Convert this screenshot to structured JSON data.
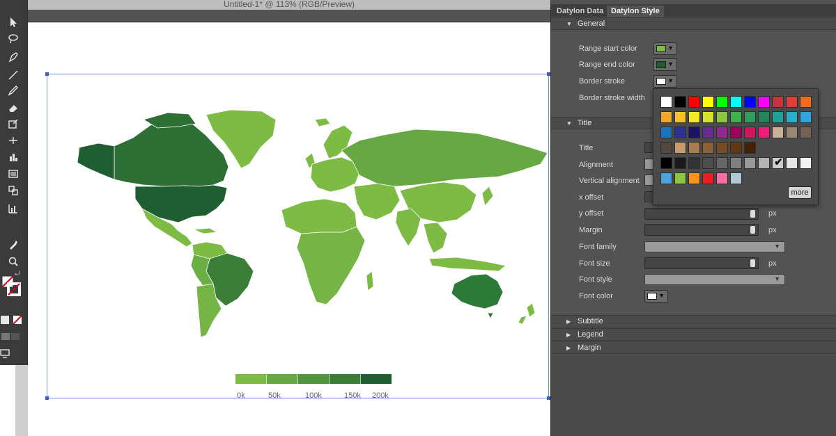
{
  "document": {
    "title": "Untitled-1* @ 113% (RGB/Preview)"
  },
  "panel": {
    "tabs": [
      {
        "label": "Datylon Data",
        "active": false
      },
      {
        "label": "Datylon Style",
        "active": true
      }
    ],
    "general": {
      "header": "General",
      "range_start_label": "Range start color",
      "range_start_color": "#7dbb45",
      "range_end_label": "Range end color",
      "range_end_color": "#1e5e30",
      "border_stroke_label": "Border stroke",
      "border_stroke_color": "#ffffff",
      "border_stroke_width_label": "Border stroke width"
    },
    "title_section": {
      "header": "Title",
      "title_label": "Title",
      "alignment_label": "Alignment",
      "vertical_alignment_label": "Vertical alignment",
      "x_offset_label": "x offset",
      "y_offset_label": "y offset",
      "y_offset_unit": "px",
      "margin_label": "Margin",
      "margin_unit": "px",
      "font_family_label": "Font family",
      "font_size_label": "Font size",
      "font_size_unit": "px",
      "font_style_label": "Font style",
      "font_color_label": "Font color",
      "font_color": "#ffffff"
    },
    "collapsed_sections": [
      "Subtitle",
      "Legend",
      "Margin"
    ]
  },
  "color_picker": {
    "rows": [
      [
        "#ffffff",
        "#000000",
        "#ff0000",
        "#ffff00",
        "#00ff00",
        "#00ffff",
        "#0000ff",
        "#ff00ff",
        "#c8323c",
        "#e33a3a",
        "#f26a22"
      ],
      [
        "#f5a623",
        "#f7c02b",
        "#f5e72b",
        "#d6e22c",
        "#8cc63f",
        "#3cb44b",
        "#2ca05a",
        "#1b8a5a",
        "#1aa39a",
        "#1fb4c9",
        "#29a9e1"
      ],
      [
        "#1c75bc",
        "#2e3192",
        "#1b1464",
        "#662d91",
        "#92278f",
        "#9e005d",
        "#d4145a",
        "#ed1e79",
        "#c7b299",
        "#998675",
        "#736357"
      ],
      [
        "#534741",
        "#c69c6d",
        "#a67c52",
        "#8c6239",
        "#754c24",
        "#603813",
        "#42210b"
      ],
      [
        "#000000",
        "#1a1a1a",
        "#333333",
        "#4d4d4d",
        "#666666",
        "#808080",
        "#999999",
        "#b3b3b3",
        "#cccccc",
        "#e6e6e6",
        "#f2f2f2"
      ],
      [
        "#4aa3df",
        "#8cc63f",
        "#f7931e",
        "#ed1c24",
        "#f46fa0",
        "#b3c7d6"
      ]
    ],
    "selected_row": 4,
    "selected_col": 8,
    "more_label": "more"
  },
  "chart_data": {
    "type": "choropleth-map",
    "title": "",
    "color_scale": {
      "start_color": "#7dbb45",
      "end_color": "#1e5e30",
      "ticks": [
        "0k",
        "50k",
        "100k",
        "150k",
        "200k"
      ]
    },
    "legend_segment_colors": [
      "#7dbb45",
      "#66a842",
      "#4f953d",
      "#3a7e37",
      "#1e5e30"
    ]
  },
  "toolbox": {
    "icons": [
      "selection-tool-icon",
      "lasso-tool-icon",
      "pen-tool-icon",
      "line-tool-icon",
      "pencil-tool-icon",
      "eraser-tool-icon",
      "scale-tool-icon",
      "width-tool-icon",
      "graph-tool-icon",
      "gradient-tool-icon",
      "blend-tool-icon",
      "column-graph-icon",
      "eyedropper-icon",
      "zoom-icon",
      "fill-stroke-icon",
      "swap-icon",
      "normal-mode-icon",
      "screen-mode-icon"
    ]
  }
}
